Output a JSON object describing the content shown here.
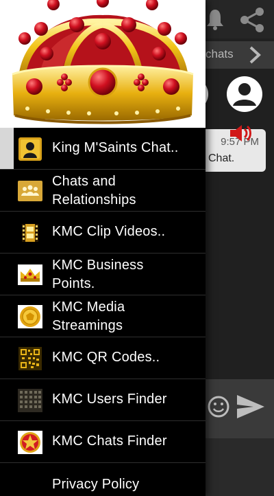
{
  "background": {
    "tab_text": "chats",
    "message_time": "9:57 PM",
    "message_text": "Chat."
  },
  "drawer": {
    "menu": [
      {
        "label": "King M'Saints Chat..",
        "icon": "person-icon",
        "active": true
      },
      {
        "label": "Chats and\nRelationships",
        "icon": "group-icon"
      },
      {
        "label": "KMC Clip Videos..",
        "icon": "film-icon"
      },
      {
        "label": "KMC Business\nPoints.",
        "icon": "crown-icon"
      },
      {
        "label": "KMC  Media\nStreamings",
        "icon": "gold-coin-icon"
      },
      {
        "label": "KMC QR Codes..",
        "icon": "qr-code-icon"
      },
      {
        "label": "KMC Users Finder",
        "icon": "grid-icon"
      },
      {
        "label": "KMC Chats Finder",
        "icon": "star-badge-icon"
      },
      {
        "label": "Privacy Policy",
        "icon": ""
      }
    ]
  },
  "colors": {
    "drawer_bg": "#000000",
    "accent_gold": "#e0b020",
    "crown_red": "#c0101a",
    "active_indicator": "#d7d7d7"
  }
}
